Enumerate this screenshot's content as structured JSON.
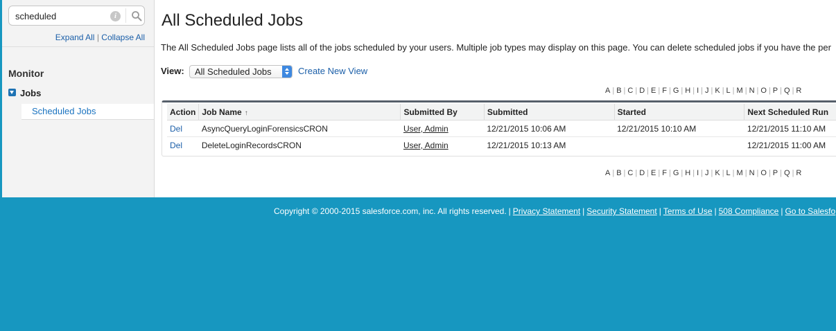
{
  "sidebar": {
    "search": {
      "value": "scheduled",
      "placeholder": ""
    },
    "expand_all": "Expand All",
    "separator": "|",
    "collapse_all": "Collapse All",
    "section_heading": "Monitor",
    "tree": {
      "parent_label": "Jobs",
      "child_label": "Scheduled Jobs"
    }
  },
  "main": {
    "title": "All Scheduled Jobs",
    "description": "The All Scheduled Jobs page lists all of the jobs scheduled by your users. Multiple job types may display on this page. You can delete scheduled jobs if you have the per",
    "view_label": "View:",
    "view_selected": "All Scheduled Jobs",
    "create_new_view": "Create New View",
    "alphabet": [
      "A",
      "B",
      "C",
      "D",
      "E",
      "F",
      "G",
      "H",
      "I",
      "J",
      "K",
      "L",
      "M",
      "N",
      "O",
      "P",
      "Q",
      "R"
    ],
    "table": {
      "headers": [
        "Action",
        "Job Name",
        "Submitted By",
        "Submitted",
        "Started",
        "Next Scheduled Run"
      ],
      "sort_indicator": "↑",
      "rows": [
        {
          "action": "Del",
          "job_name": "AsyncQueryLoginForensicsCRON",
          "submitted_by": "User, Admin",
          "submitted": "12/21/2015 10:06 AM",
          "started": "12/21/2015 10:10 AM",
          "next_run": "12/21/2015 11:10 AM"
        },
        {
          "action": "Del",
          "job_name": "DeleteLoginRecordsCRON",
          "submitted_by": "User, Admin",
          "submitted": "12/21/2015 10:13 AM",
          "started": "",
          "next_run": "12/21/2015 11:00 AM"
        }
      ]
    }
  },
  "footer": {
    "copyright": "Copyright © 2000-2015 salesforce.com, inc. All rights reserved.",
    "links": [
      "Privacy Statement",
      "Security Statement",
      "Terms of Use",
      "508 Compliance",
      "Go to Salesfo"
    ]
  },
  "colors": {
    "background_blue": "#1797c0",
    "link_blue": "#1a5ea8",
    "table_header_bar": "#565f6a"
  }
}
